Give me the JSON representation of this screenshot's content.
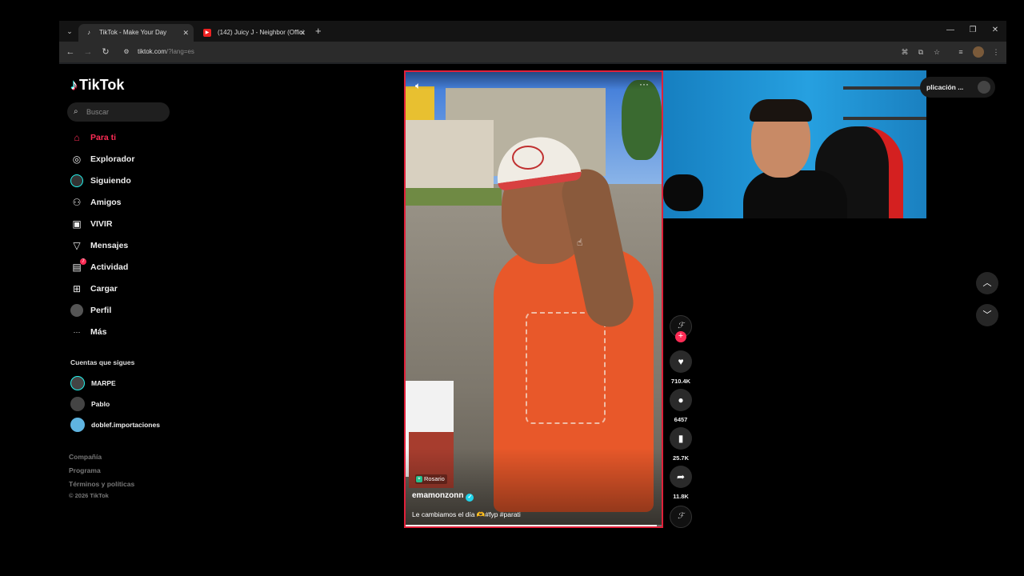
{
  "browser": {
    "tabs": [
      {
        "title": "TikTok - Make Your Day",
        "active": true
      },
      {
        "title": "(142) Juicy J - Neighbor (Offici",
        "active": false
      }
    ],
    "new_tab": "+",
    "tab_close": "✕",
    "url_host": "tiktok.com",
    "url_rest": "/?lang=es",
    "window_controls": [
      "—",
      "❐",
      "✕"
    ]
  },
  "sidebar": {
    "logo_text": "TikTok",
    "search_placeholder": "Buscar",
    "nav": [
      {
        "label": "Para ti",
        "icon": "home-icon",
        "glyph": "⌂",
        "active": true
      },
      {
        "label": "Explorador",
        "icon": "compass-icon",
        "glyph": "◎",
        "active": false
      },
      {
        "label": "Siguiendo",
        "icon": "following-avatar-icon",
        "glyph": "",
        "active": false
      },
      {
        "label": "Amigos",
        "icon": "friends-icon",
        "glyph": "⚇",
        "active": false
      },
      {
        "label": "VIVIR",
        "icon": "live-tv-icon",
        "glyph": "▣",
        "active": false
      },
      {
        "label": "Mensajes",
        "icon": "send-icon",
        "glyph": "▽",
        "active": false
      },
      {
        "label": "Actividad",
        "icon": "activity-icon",
        "glyph": "▤",
        "active": false,
        "badge": "7"
      },
      {
        "label": "Cargar",
        "icon": "upload-icon",
        "glyph": "⊞",
        "active": false
      },
      {
        "label": "Perfil",
        "icon": "profile-avatar-icon",
        "glyph": "",
        "active": false
      },
      {
        "label": "Más",
        "icon": "more-icon",
        "glyph": "···",
        "active": false
      }
    ],
    "following_title": "Cuentas que sigues",
    "following": [
      {
        "label": "MARPE"
      },
      {
        "label": "Pablo"
      },
      {
        "label": "doblef.importaciones"
      }
    ],
    "footer": [
      "Compañía",
      "Programa",
      "Términos y políticas"
    ],
    "copyright": "© 2026 TikTok"
  },
  "video": {
    "location": "Rosario",
    "author": "emamonzonn",
    "caption": "Le cambiamos el día 🫶#fyp #parati",
    "progress": 0.98
  },
  "actions": {
    "likes": "710.4K",
    "comments": "6457",
    "saves": "25.7K",
    "shares": "11.8K"
  },
  "get_app": "plicación ..."
}
